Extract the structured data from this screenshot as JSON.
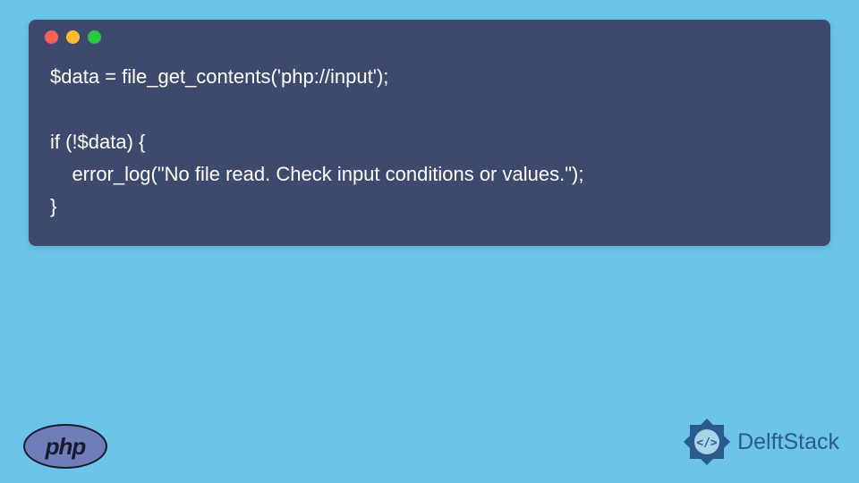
{
  "code": {
    "line1": "$data = file_get_contents('php://input');",
    "line2": "",
    "line3": "if (!$data) {",
    "line4": "    error_log(\"No file read. Check input conditions or values.\");",
    "line5": "}"
  },
  "php_label": "php",
  "brand": "DelftStack"
}
